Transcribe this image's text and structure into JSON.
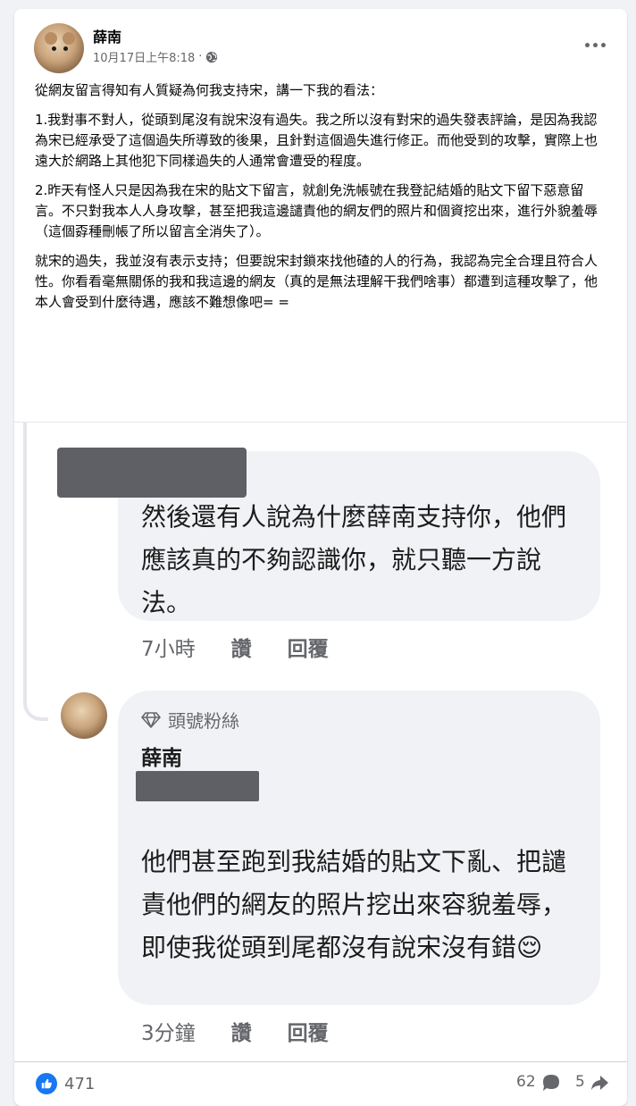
{
  "post": {
    "author": "薛南",
    "timestamp": "10月17日上午8:18",
    "separator": "·",
    "visibility_icon": "globe-icon",
    "more_icon": "more-options-icon",
    "paragraphs": [
      "從網友留言得知有人質疑為何我支持宋，講一下我的看法：",
      "1.我對事不對人，從頭到尾沒有說宋沒有過失。我之所以沒有對宋的過失發表評論，是因為我認為宋已經承受了這個過失所導致的後果，且針對這個過失進行修正。而他受到的攻擊，實際上也遠大於網路上其他犯下同樣過失的人通常會遭受的程度。",
      "2.昨天有怪人只是因為我在宋的貼文下留言，就創免洗帳號在我登記結婚的貼文下留下惡意留言。不只對我本人人身攻擊，甚至把我這邊譴責他的網友們的照片和個資挖出來，進行外貌羞辱（這個孬種刪帳了所以留言全消失了）。",
      "就宋的過失，我並沒有表示支持；但要說宋封鎖來找他碴的人的行為，我認為完全合理且符合人性。你看看毫無關係的我和我這邊的網友（真的是無法理解干我們啥事）都遭到這種攻擊了，他本人會受到什麼待遇，應該不難想像吧= ="
    ]
  },
  "screenshot": {
    "comment1": {
      "text": "然後還有人說為什麼薛南支持你，他們應該真的不夠認識你，就只聽一方說法。",
      "time": "7小時",
      "like_label": "讚",
      "reply_label": "回覆"
    },
    "comment2": {
      "badge": "頭號粉絲",
      "badge_icon": "diamond-icon",
      "name": "薛南",
      "text": "他們甚至跑到我結婚的貼文下亂、把譴責他們的網友的照片挖出來容貌羞辱，即使我從頭到尾都沒有說宋沒有錯😌",
      "time": "3分鐘",
      "like_label": "讚",
      "reply_label": "回覆"
    }
  },
  "stats": {
    "likes": "471",
    "comments": "62",
    "shares": "5"
  },
  "colors": {
    "accent": "#1877f2",
    "secondary_text": "#65676b",
    "bubble": "#f0f2f5",
    "redaction": "#5f6065"
  }
}
